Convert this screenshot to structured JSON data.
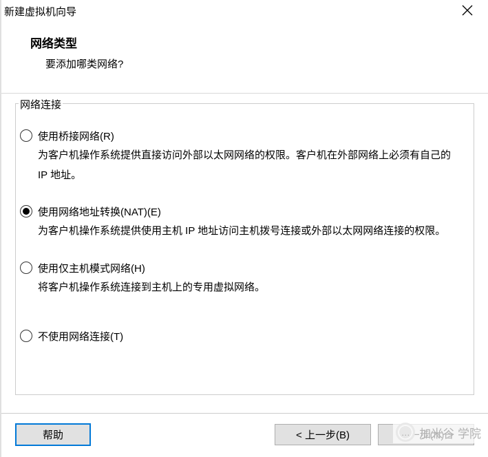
{
  "window": {
    "title": "新建虚拟机向导"
  },
  "header": {
    "title": "网络类型",
    "subtitle": "要添加哪类网络?"
  },
  "group": {
    "legend": "网络连接",
    "options": [
      {
        "label": "使用桥接网络(R)",
        "desc": "为客户机操作系统提供直接访问外部以太网网络的权限。客户机在外部网络上必须有自己的 IP 地址。",
        "selected": false
      },
      {
        "label": "使用网络地址转换(NAT)(E)",
        "desc": "为客户机操作系统提供使用主机 IP 地址访问主机拨号连接或外部以太网网络连接的权限。",
        "selected": true
      },
      {
        "label": "使用仅主机模式网络(H)",
        "desc": "将客户机操作系统连接到主机上的专用虚拟网络。",
        "selected": false
      },
      {
        "label": "不使用网络连接(T)",
        "desc": "",
        "selected": false
      }
    ]
  },
  "buttons": {
    "help": "帮助",
    "back": "< 上一步(B)",
    "next": "下一步(N) >"
  },
  "watermark": {
    "text": "加米谷 学院"
  }
}
